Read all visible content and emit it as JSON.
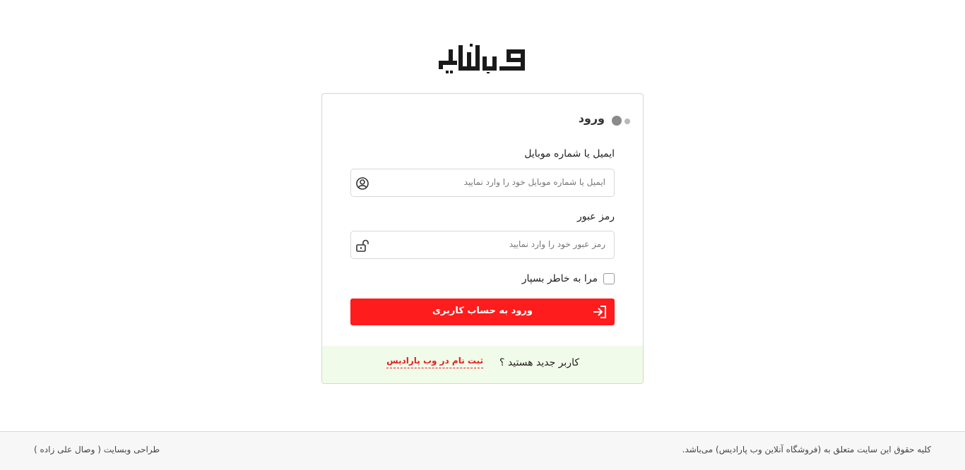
{
  "brand": {
    "logo_text": "وب پارادایس"
  },
  "login_card": {
    "title": "ورود",
    "identifier": {
      "label": "ایمیل یا شماره موبایل",
      "placeholder": "ایمیل یا شماره موبایل خود را وارد نمایید",
      "value": "",
      "icon": "user-circle-icon"
    },
    "password": {
      "label": "رمز عبور",
      "placeholder": "رمز عبور خود را وارد نمایید",
      "value": "",
      "icon": "unlock-icon"
    },
    "remember_label": "مرا به خاطر بسپار",
    "submit_label": "ورود به حساب کاربری",
    "submit_icon": "sign-in-icon",
    "register_question": "کاربر جدید هستید ؟",
    "register_link": "ثبت نام در وب پارادیس"
  },
  "footer": {
    "copyright": "کلیه حقوق این سایت متعلق به (فروشگاه آنلاین وب پارادیس) می‌باشد.",
    "credit": "طراحی وبسایت ( وصال علی زاده )"
  },
  "colors": {
    "accent": "#ff1c1c",
    "link": "#e51d1d",
    "register_bg": "#f1fbe9",
    "footer_bg": "#f7f7f8"
  }
}
